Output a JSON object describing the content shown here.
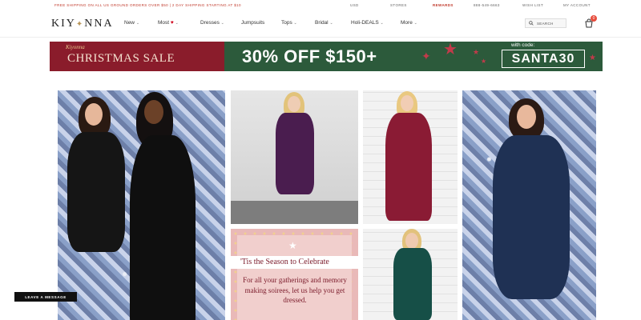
{
  "topbar": {
    "promo": "FREE SHIPPING ON ALL US GROUND ORDERS OVER $50 | 2 DAY SHIPPING STARTING AT $10",
    "links": [
      "USD",
      "STORES",
      "REWARDS",
      "888-549-6663",
      "WISH LIST",
      "MY ACCOUNT"
    ]
  },
  "header": {
    "logo": "KIY",
    "logo_rest": "NNA",
    "nav": [
      "New",
      "Most",
      "Dresses",
      "Jumpsuits",
      "Tops",
      "Bridal",
      "Holi-DEALS",
      "More"
    ],
    "search_label": "SEARCH",
    "cart_count": "0"
  },
  "banner": {
    "brand": "Kiyonna",
    "sale": "CHRISTMAS SALE",
    "offer": "30% OFF $150+",
    "with_code": "with code:",
    "code": "SANTA30",
    "colors": {
      "left": "#8a1c2b",
      "right": "#2c5a3b"
    }
  },
  "promo_card": {
    "title": "'Tis the Season to Celebrate",
    "body": "For all your gatherings and memory making soirees, let us help you get dressed."
  },
  "chat": {
    "label": "LEAVE A MESSAGE"
  },
  "icons": [
    "search-icon",
    "cart-icon",
    "heart-icon",
    "chevron-down-icon",
    "star-icon"
  ]
}
